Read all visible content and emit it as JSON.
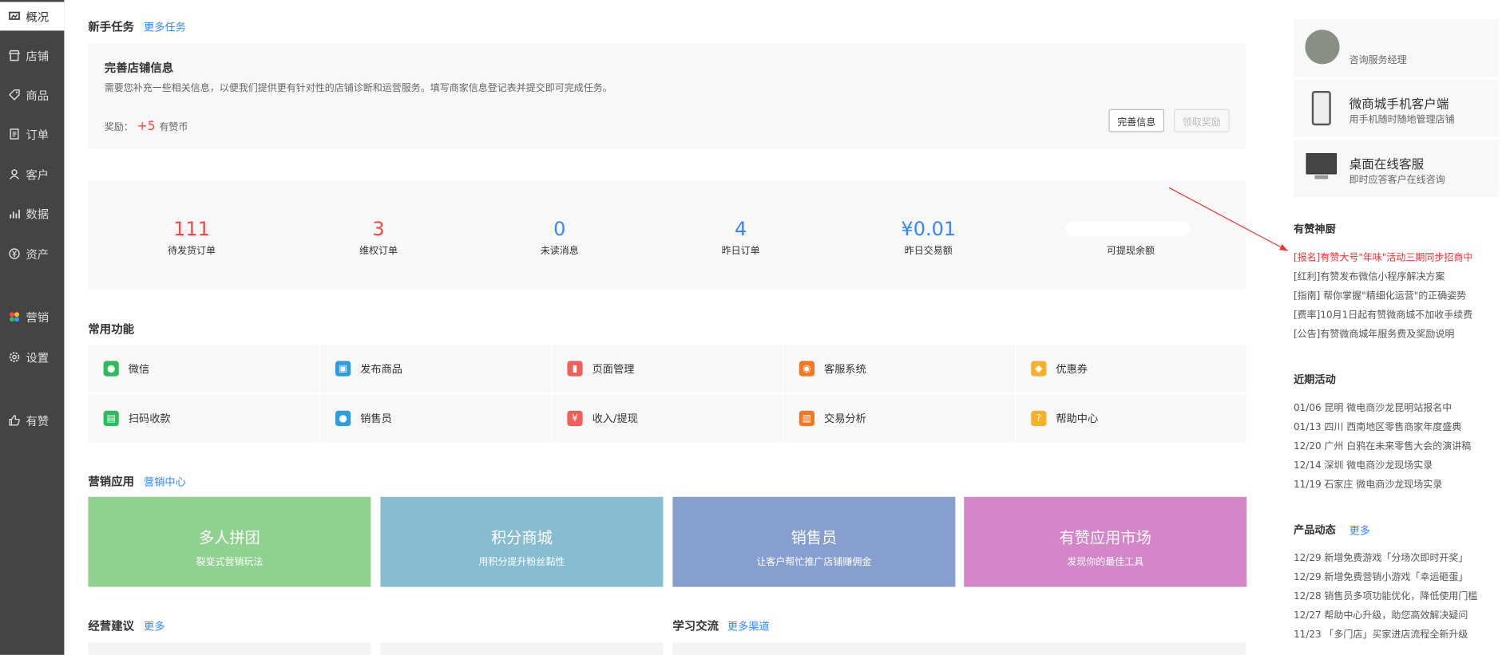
{
  "sidebar": {
    "items": [
      {
        "label": "概况",
        "icon": "dashboard-icon",
        "active": true
      },
      {
        "label": "店铺",
        "icon": "store-icon"
      },
      {
        "label": "商品",
        "icon": "tag-icon"
      },
      {
        "label": "订单",
        "icon": "order-icon"
      },
      {
        "label": "客户",
        "icon": "user-icon"
      },
      {
        "label": "数据",
        "icon": "chart-icon"
      },
      {
        "label": "资产",
        "icon": "yen-icon"
      },
      {
        "label": "营销",
        "icon": "marketing-icon"
      },
      {
        "label": "设置",
        "icon": "gear-icon"
      },
      {
        "label": "有赞",
        "icon": "thumb-icon"
      }
    ]
  },
  "newbie": {
    "title": "新手任务",
    "more": "更多任务",
    "task_title": "完善店铺信息",
    "task_desc": "需要您补充一些相关信息，以便我们提供更有针对性的店铺诊断和运营服务。填写商家信息登记表并提交即可完成任务。",
    "reward_label": "奖励：",
    "reward_value": "+5",
    "reward_unit": "有赞币",
    "btn_complete": "完善信息",
    "btn_claim": "领取奖励"
  },
  "stats": [
    {
      "value": "111",
      "label": "待发货订单",
      "color": "red"
    },
    {
      "value": "3",
      "label": "维权订单",
      "color": "red"
    },
    {
      "value": "0",
      "label": "未读消息",
      "color": "blue"
    },
    {
      "value": "4",
      "label": "昨日订单",
      "color": "blue"
    },
    {
      "value": "¥0.01",
      "label": "昨日交易额",
      "color": "blue"
    },
    {
      "value": "",
      "label": "可提现余额",
      "color": "blue"
    }
  ],
  "common": {
    "title": "常用功能",
    "items": [
      {
        "label": "微信",
        "icon": "wechat-icon",
        "color": "#2bbc5d"
      },
      {
        "label": "发布商品",
        "icon": "publish-icon",
        "color": "#2d9ee0"
      },
      {
        "label": "页面管理",
        "icon": "page-icon",
        "color": "#f0605a"
      },
      {
        "label": "客服系统",
        "icon": "service-icon",
        "color": "#f7771f"
      },
      {
        "label": "优惠券",
        "icon": "coupon-icon",
        "color": "#f6b22a"
      },
      {
        "label": "扫码收款",
        "icon": "scan-pay-icon",
        "color": "#2bbc5d"
      },
      {
        "label": "销售员",
        "icon": "salesperson-icon",
        "color": "#2d9ee0"
      },
      {
        "label": "收入/提现",
        "icon": "income-icon",
        "color": "#f0605a"
      },
      {
        "label": "交易分析",
        "icon": "analysis-icon",
        "color": "#f7771f"
      },
      {
        "label": "帮助中心",
        "icon": "help-icon",
        "color": "#f6b22a"
      }
    ]
  },
  "marketing": {
    "title": "营销应用",
    "more": "营销中心",
    "cards": [
      {
        "title": "多人拼团",
        "sub": "裂变式营销玩法",
        "color": "#8fd18e"
      },
      {
        "title": "积分商城",
        "sub": "用积分提升粉丝黏性",
        "color": "#86bdd0"
      },
      {
        "title": "销售员",
        "sub": "让客户帮忙推广店铺赚佣金",
        "color": "#879ed0"
      },
      {
        "title": "有赞应用市场",
        "sub": "发现你的最佳工具",
        "color": "#d586c8"
      }
    ]
  },
  "bottom": {
    "advice_title": "经营建议",
    "advice_more": "更多",
    "learn_title": "学习交流",
    "learn_more": "更多渠道"
  },
  "right": {
    "consultant_role": "咨询服务经理",
    "mobile_title": "微商城手机客户端",
    "mobile_sub": "用手机随时随地管理店铺",
    "desktop_title": "桌面在线客服",
    "desktop_sub": "即时应答客户在线咨询",
    "chef_title": "有赞神厨",
    "chef_items": [
      "[报名]有赞大号\"年味\"活动三期同步招商中",
      "[红利]有赞发布微信小程序解决方案",
      "[指南] 帮你掌握\"精细化运营\"的正确姿势",
      "[费率]10月1日起有赞微商城不加收手续费",
      "[公告]有赞微商城年服务费及奖励说明"
    ],
    "events_title": "近期活动",
    "events": [
      "01/06 昆明 微电商沙龙昆明站报名中",
      "01/13 四川 西南地区零售商家年度盛典",
      "12/20 广州 白鸦在未来零售大会的演讲稿",
      "12/14 深圳 微电商沙龙现场实录",
      "11/19 石家庄 微电商沙龙现场实录"
    ],
    "product_title": "产品动态",
    "product_more": "更多",
    "products": [
      "12/29 新增免费游戏「分场次即时开奖」",
      "12/29 新增免费营销小游戏「幸运砸蛋」",
      "12/28 销售员多项功能优化，降低使用门槛",
      "12/27 帮助中心升级，助您高效解决疑问",
      "11/23 「多门店」买家进店流程全新升级"
    ]
  }
}
